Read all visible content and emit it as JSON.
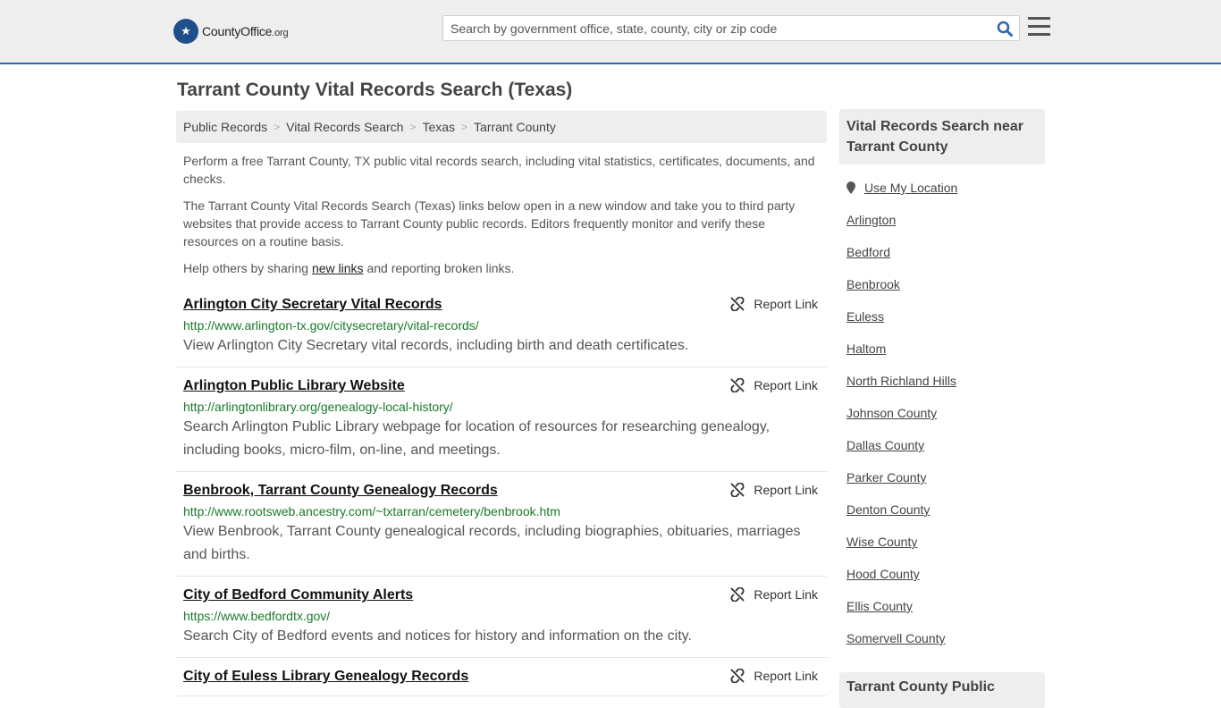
{
  "header": {
    "logo_main": "CountyOffice",
    "logo_tld": ".org",
    "search_placeholder": "Search by government office, state, county, city or zip code"
  },
  "page_title": "Tarrant County Vital Records Search (Texas)",
  "breadcrumb": [
    "Public Records",
    "Vital Records Search",
    "Texas",
    "Tarrant County"
  ],
  "intro": {
    "p1": "Perform a free Tarrant County, TX public vital records search, including vital statistics, certificates, documents, and checks.",
    "p2": "The Tarrant County Vital Records Search (Texas) links below open in a new window and take you to third party websites that provide access to Tarrant County public records. Editors frequently monitor and verify these resources on a routine basis.",
    "p3_before": "Help others by sharing ",
    "p3_link": "new links",
    "p3_after": " and reporting broken links."
  },
  "report_label": "Report Link",
  "records": [
    {
      "title": "Arlington City Secretary Vital Records",
      "url": "http://www.arlington-tx.gov/citysecretary/vital-records/",
      "desc": "View Arlington City Secretary vital records, including birth and death certificates."
    },
    {
      "title": "Arlington Public Library Website",
      "url": "http://arlingtonlibrary.org/genealogy-local-history/",
      "desc": "Search Arlington Public Library webpage for location of resources for researching genealogy, including books, micro-film, on-line, and meetings."
    },
    {
      "title": "Benbrook, Tarrant County Genealogy Records",
      "url": "http://www.rootsweb.ancestry.com/~txtarran/cemetery/benbrook.htm",
      "desc": "View Benbrook, Tarrant County genealogical records, including biographies, obituaries, marriages and births."
    },
    {
      "title": "City of Bedford Community Alerts",
      "url": "https://www.bedfordtx.gov/",
      "desc": "Search City of Bedford events and notices for history and information on the city."
    },
    {
      "title": "City of Euless Library Genealogy Records",
      "url": "",
      "desc": ""
    }
  ],
  "sidebar": {
    "heading": "Vital Records Search near Tarrant County",
    "use_location": "Use My Location",
    "items": [
      "Arlington",
      "Bedford",
      "Benbrook",
      "Euless",
      "Haltom",
      "North Richland Hills",
      "Johnson County",
      "Dallas County",
      "Parker County",
      "Denton County",
      "Wise County",
      "Hood County",
      "Ellis County",
      "Somervell County"
    ],
    "heading2": "Tarrant County Public"
  }
}
